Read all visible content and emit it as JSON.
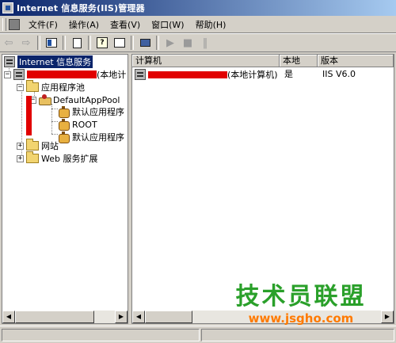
{
  "window": {
    "title": "Internet 信息服务(IIS)管理器"
  },
  "menu": {
    "items": [
      {
        "label": "文件(F)"
      },
      {
        "label": "操作(A)"
      },
      {
        "label": "查看(V)"
      },
      {
        "label": "窗口(W)"
      },
      {
        "label": "帮助(H)"
      }
    ]
  },
  "toolbar": {
    "buttons": [
      {
        "icon": "back-arrow-icon",
        "glyph": "⇦",
        "enabled": false
      },
      {
        "icon": "forward-arrow-icon",
        "glyph": "⇨",
        "enabled": false
      },
      {
        "icon": "show-hide-tree-icon",
        "enabled": true
      },
      {
        "icon": "export-list-icon",
        "enabled": true
      },
      {
        "icon": "help-icon",
        "glyph": "?",
        "enabled": true
      },
      {
        "icon": "properties-icon",
        "enabled": true
      },
      {
        "icon": "connect-computer-icon",
        "enabled": true
      },
      {
        "icon": "play-icon",
        "glyph": "▶",
        "enabled": false
      },
      {
        "icon": "stop-icon",
        "glyph": "■",
        "enabled": false
      },
      {
        "icon": "pause-icon",
        "glyph": "‖",
        "enabled": false
      }
    ]
  },
  "tree": {
    "root": "Internet 信息服务",
    "computer": "(本地计",
    "app_pools": "应用程序池",
    "default_pool": "DefaultAppPool",
    "pool_children": [
      "默认应用程序",
      "ROOT",
      "默认应用程序"
    ],
    "websites": "网站",
    "web_ext": "Web 服务扩展"
  },
  "list": {
    "columns": [
      "计算机",
      "本地",
      "版本"
    ],
    "rows": [
      {
        "computer": "(本地计算机)",
        "local": "是",
        "version": "IIS V6.0"
      }
    ]
  },
  "colors": {
    "titlebar": "#0a246a",
    "selection": "#0a246a",
    "redaction": "#e10000",
    "watermark_text": "#2aa02a",
    "watermark_url": "#ff7a00"
  },
  "watermark": {
    "logo": "技术员联盟",
    "url": "www.jsgho.com"
  }
}
